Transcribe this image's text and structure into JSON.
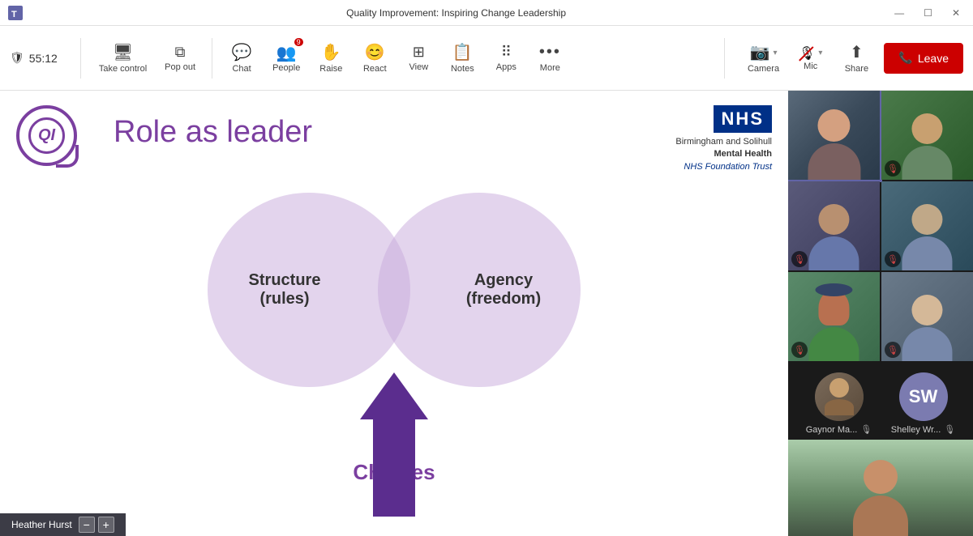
{
  "titlebar": {
    "title": "Quality Improvement: Inspiring Change Leadership",
    "app": "Microsoft Teams"
  },
  "toolbar": {
    "timer": "55:12",
    "take_control_label": "Take control",
    "pop_out_label": "Pop out",
    "chat_label": "Chat",
    "people_label": "People",
    "people_count": "9",
    "raise_label": "Raise",
    "react_label": "React",
    "view_label": "View",
    "notes_label": "Notes",
    "apps_label": "Apps",
    "more_label": "More",
    "camera_label": "Camera",
    "mic_label": "Mic",
    "share_label": "Share",
    "leave_label": "Leave"
  },
  "slide": {
    "title": "Role as leader",
    "left_circle_label": "Structure\n(rules)",
    "right_circle_label": "Agency\n(freedom)",
    "choices_label": "Choices",
    "nhs_badge": "NHS",
    "nhs_org_line1": "Birmingham and Solihull",
    "nhs_org_line2": "Mental Health",
    "nhs_org_line3": "NHS Foundation Trust"
  },
  "participants": {
    "avatar1_name": "Gaynor Ma...",
    "avatar2_name": "Shelley Wr...",
    "avatar2_initials": "SW"
  },
  "bottombar": {
    "name": "Heather Hurst",
    "minus": "−",
    "plus": "+"
  }
}
